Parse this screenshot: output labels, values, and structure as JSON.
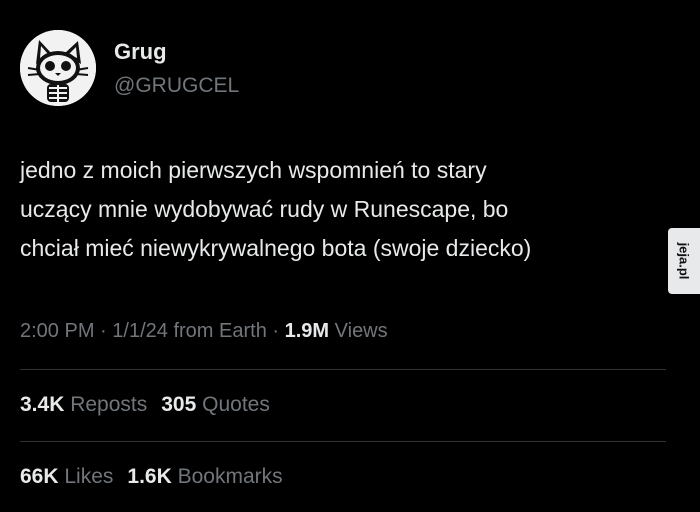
{
  "author": {
    "name": "Grug",
    "handle": "@GRUGCEL",
    "avatar_icon": "cat-skeleton-avatar"
  },
  "tweet": {
    "lines": [
      "jedno z moich pierwszych wspomnień to stary",
      "uczący mnie wydobywać rudy w Runescape, bo",
      "chciał mieć niewykrywalnego bota (swoje dziecko)"
    ]
  },
  "meta": {
    "time": "2:00 PM",
    "date": "1/1/24",
    "source": "from Earth",
    "separator": "·",
    "views_count": "1.9M",
    "views_label": "Views"
  },
  "engagement": {
    "reposts_count": "3.4K",
    "reposts_label": "Reposts",
    "quotes_count": "305",
    "quotes_label": "Quotes",
    "likes_count": "66K",
    "likes_label": "Likes",
    "bookmarks_count": "1.6K",
    "bookmarks_label": "Bookmarks"
  },
  "watermark": {
    "text": "jeja.pl"
  },
  "colors": {
    "background": "#000000",
    "primary_text": "#e7e9ea",
    "secondary_text": "#71767b",
    "divider": "#2f3336"
  }
}
